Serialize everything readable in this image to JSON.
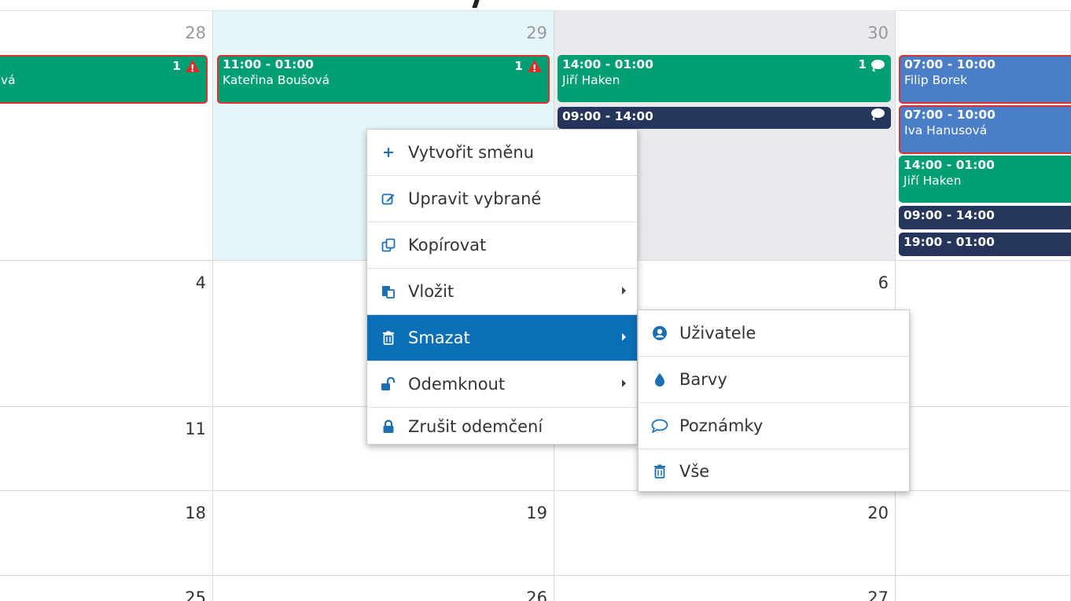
{
  "calendar": {
    "weeks": [
      {
        "days": [
          "28",
          "29",
          "30",
          ""
        ]
      },
      {
        "days": [
          "4",
          "",
          "6",
          ""
        ]
      },
      {
        "days": [
          "11",
          "",
          "",
          ""
        ]
      },
      {
        "days": [
          "18",
          "19",
          "20",
          ""
        ]
      },
      {
        "days": [
          "25",
          "26",
          "27",
          ""
        ]
      }
    ],
    "shifts": {
      "c28_1": {
        "name": "vá",
        "count": "1"
      },
      "c29_1": {
        "time": "11:00 - 01:00",
        "name": "Kateřina Boušová",
        "count": "1"
      },
      "c30_1": {
        "time": "14:00 - 01:00",
        "name": "Jiří Haken",
        "count": "1"
      },
      "c30_2": {
        "time": "09:00 - 14:00"
      },
      "c31_1": {
        "time": "07:00 - 10:00",
        "name": "Filip Borek"
      },
      "c31_2": {
        "time": "07:00 - 10:00",
        "name": "Iva Hanusová"
      },
      "c31_3": {
        "time": "14:00 - 01:00",
        "name": "Jiří Haken"
      },
      "c31_4": {
        "time": "09:00 - 14:00"
      },
      "c31_5": {
        "time": "19:00 - 01:00"
      }
    },
    "colors": {
      "green": "#009e73",
      "navy": "#25355c",
      "blue": "#4a7fc8",
      "selected": "#e5f6fa",
      "alert": "#e03030"
    }
  },
  "context_menu": {
    "items": [
      {
        "label": "Vytvořit směnu",
        "icon": "plus-icon"
      },
      {
        "label": "Upravit vybrané",
        "icon": "edit-icon"
      },
      {
        "label": "Kopírovat",
        "icon": "copy-icon"
      },
      {
        "label": "Vložit",
        "icon": "paste-icon"
      },
      {
        "label": "Smazat",
        "icon": "trash-icon"
      },
      {
        "label": "Odemknout",
        "icon": "unlock-icon"
      },
      {
        "label": "Zrušit odemčení",
        "icon": "lock-icon"
      }
    ],
    "active_color": "#0a6fb7"
  },
  "submenu": {
    "items": [
      {
        "label": "Uživatele",
        "icon": "user-circle-icon"
      },
      {
        "label": "Barvy",
        "icon": "drop-icon"
      },
      {
        "label": "Poznámky",
        "icon": "comment-icon"
      },
      {
        "label": "Vše",
        "icon": "trash-icon"
      }
    ]
  }
}
